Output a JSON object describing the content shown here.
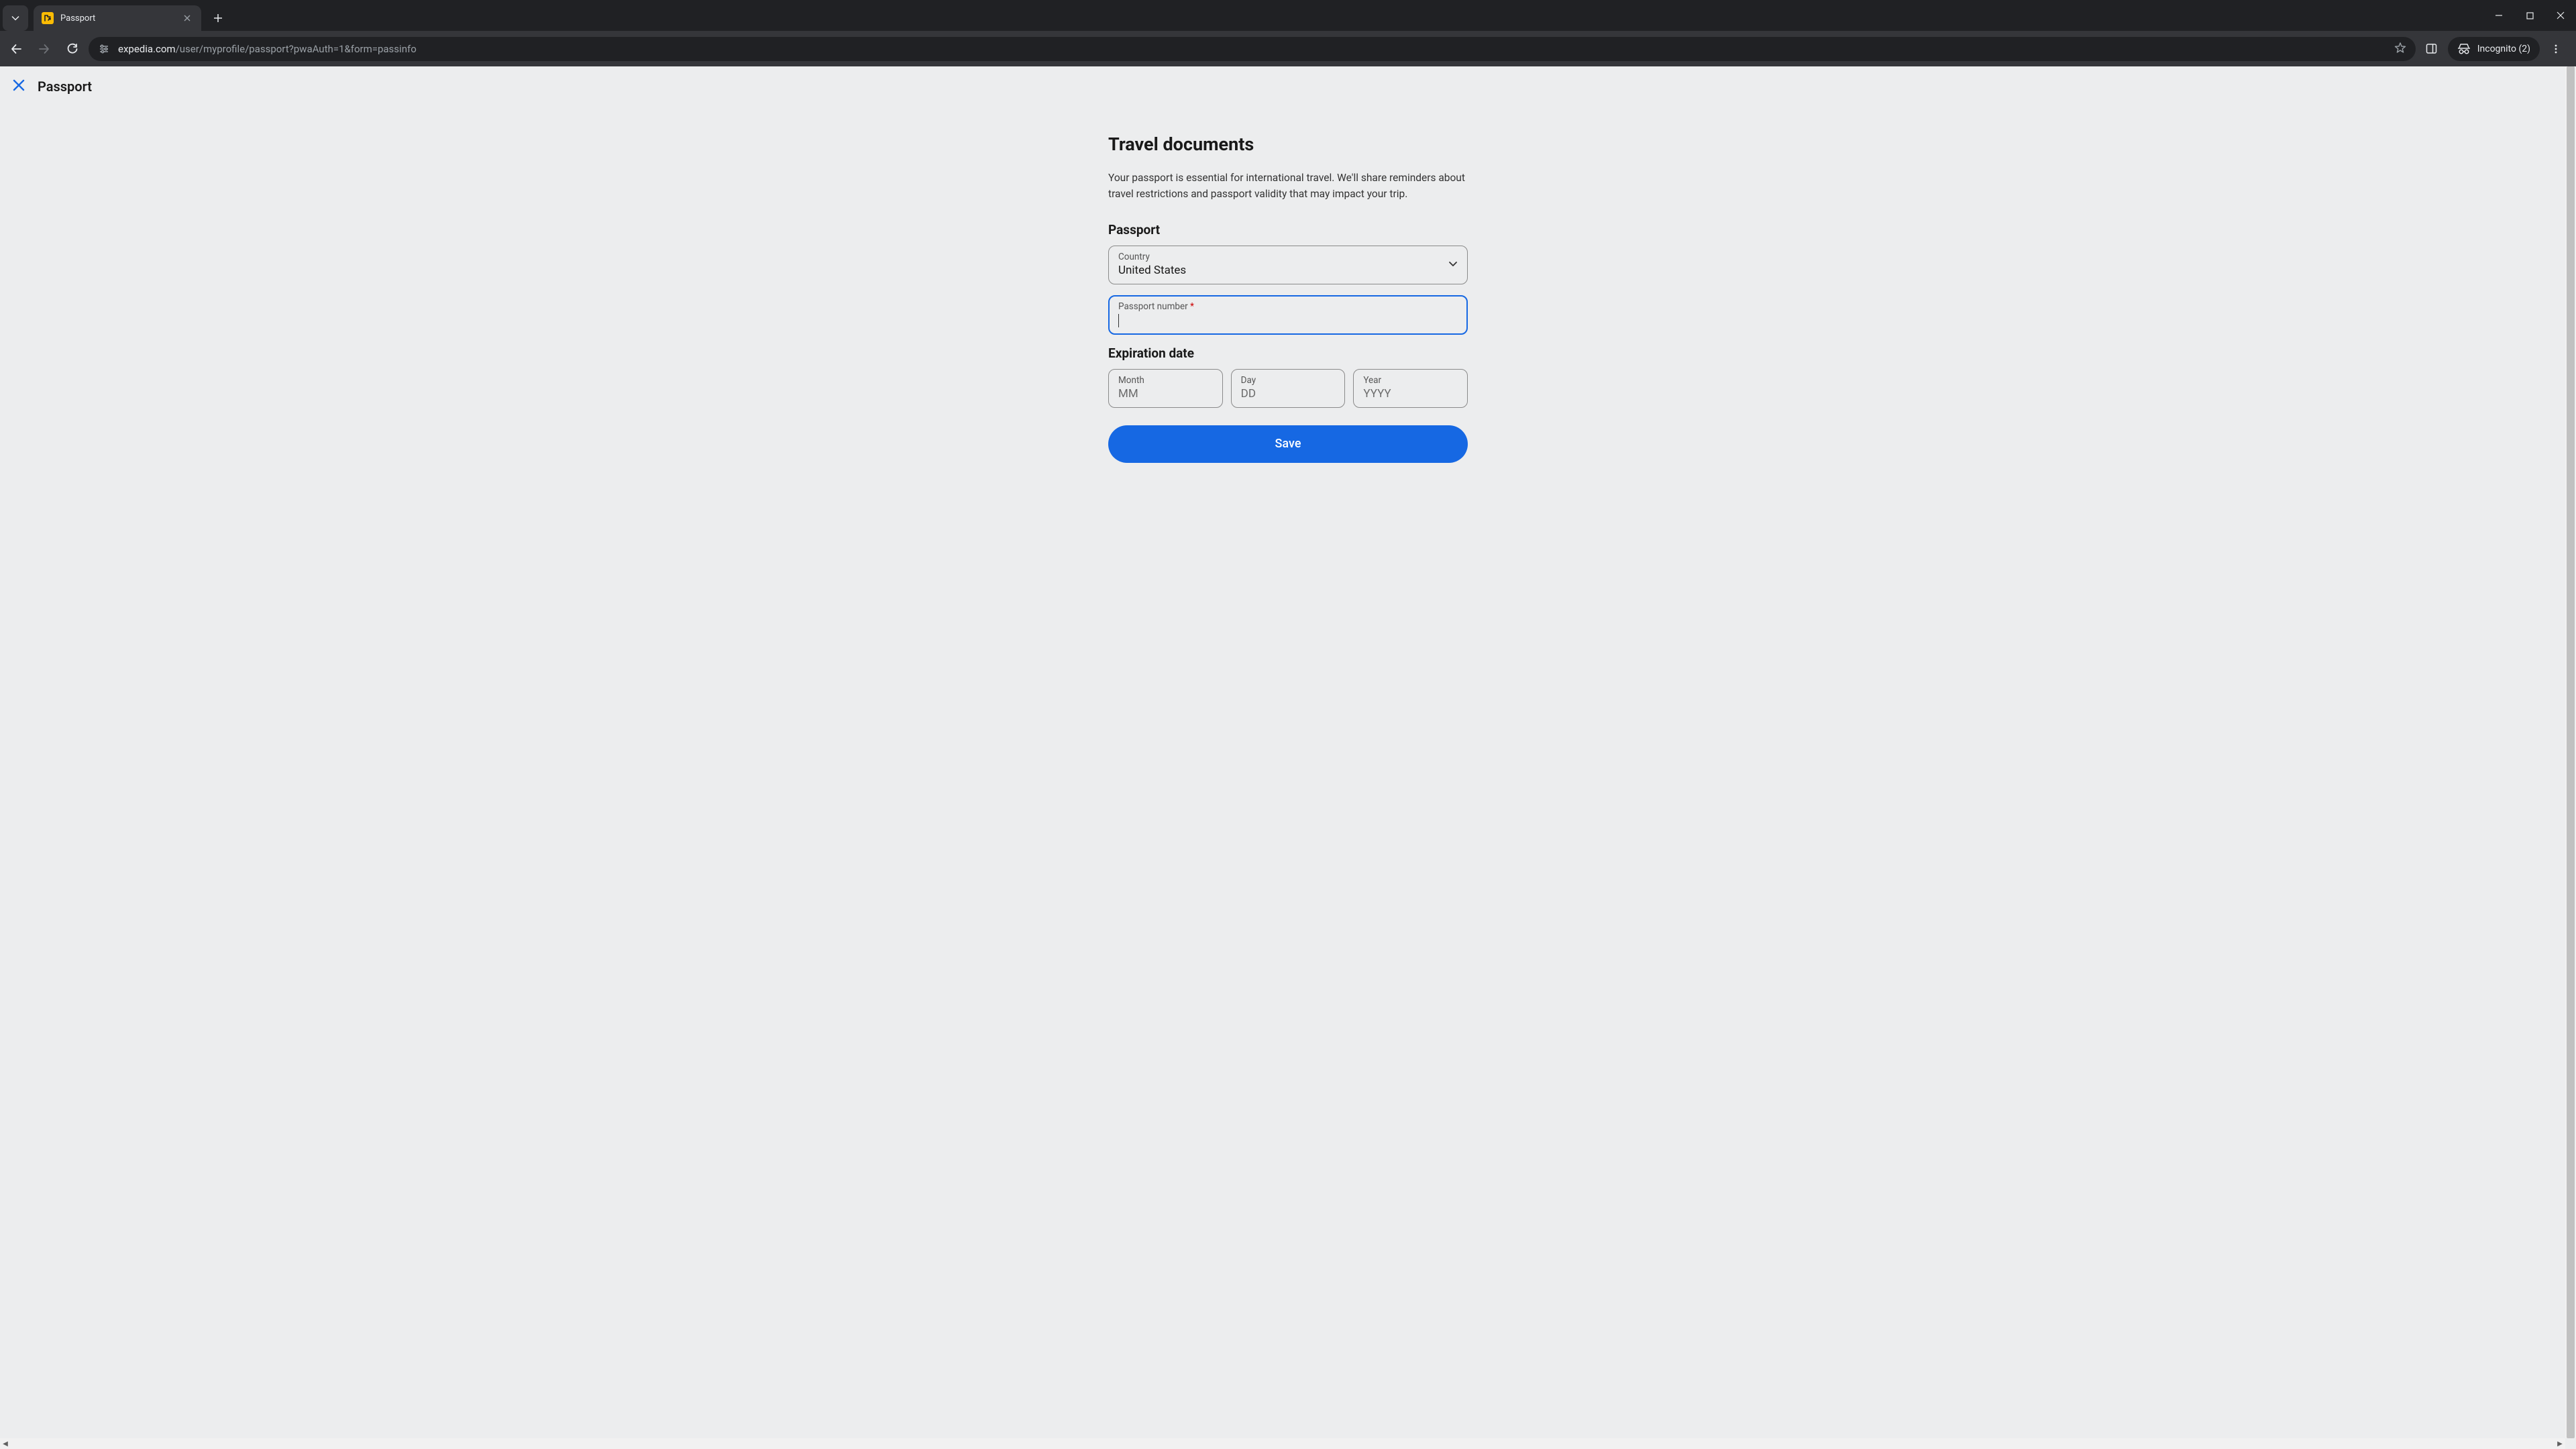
{
  "browser": {
    "tab_title": "Passport",
    "url_host": "expedia.com",
    "url_path": "/user/myprofile/passport?pwaAuth=1&form=passinfo",
    "incognito_label": "Incognito (2)"
  },
  "page": {
    "header_title": "Passport",
    "heading": "Travel documents",
    "subtext": "Your passport is essential for international travel. We'll share reminders about travel restrictions and passport validity that may impact your trip.",
    "passport_section": "Passport",
    "country_label": "Country",
    "country_value": "United States",
    "passport_number_label": "Passport number",
    "passport_number_value": "",
    "required_mark": "*",
    "expiration_section": "Expiration date",
    "month_label": "Month",
    "month_placeholder": "MM",
    "day_label": "Day",
    "day_placeholder": "DD",
    "year_label": "Year",
    "year_placeholder": "YYYY",
    "save_label": "Save"
  }
}
